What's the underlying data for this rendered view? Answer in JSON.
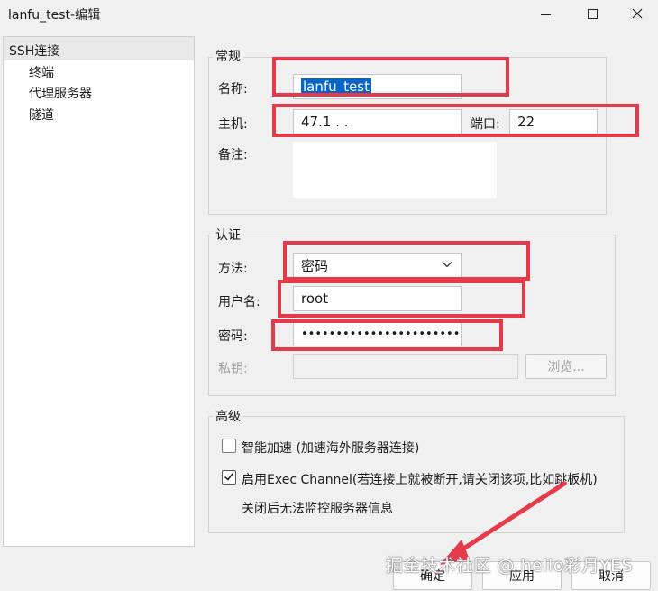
{
  "window": {
    "title": "lanfu_test-编辑"
  },
  "tree": {
    "items": [
      {
        "label": "SSH连接"
      },
      {
        "label": "终端"
      },
      {
        "label": "代理服务器"
      },
      {
        "label": "隧道"
      }
    ]
  },
  "general": {
    "legend": "常规",
    "name_label": "名称:",
    "name_value": "lanfu_test",
    "host_label": "主机:",
    "host_value": "47.1    .  .",
    "port_label": "端口:",
    "port_value": "22",
    "note_label": "备注:",
    "note_value": ""
  },
  "auth": {
    "legend": "认证",
    "method_label": "方法:",
    "method_value": "密码",
    "user_label": "用户名:",
    "user_value": "root",
    "password_label": "密码:",
    "password_value": "•••••••••••••••••••••••",
    "key_label": "私钥:",
    "key_value": "",
    "browse_label": "浏览..."
  },
  "advanced": {
    "legend": "高级",
    "smart_accel_label": "智能加速 (加速海外服务器连接)",
    "smart_accel_checked": false,
    "exec_channel_label": "启用Exec Channel(若连接上就被断开,请关闭该项,比如跳板机)",
    "exec_channel_checked": true,
    "exec_channel_note": "关闭后无法监控服务器信息"
  },
  "footer": {
    "ok_label": "确定",
    "apply_label": "应用",
    "cancel_label": "取消"
  },
  "watermark": {
    "text": "掘金技术社区 @ hello彩月YES"
  },
  "icons": {
    "minimize": "minimize-icon",
    "maximize": "maximize-icon",
    "close": "close-icon",
    "caret": "chevron-down-icon",
    "check": "checkmark-icon"
  },
  "colors": {
    "highlight": "#e63a4a",
    "selection": "#0a64c8"
  }
}
